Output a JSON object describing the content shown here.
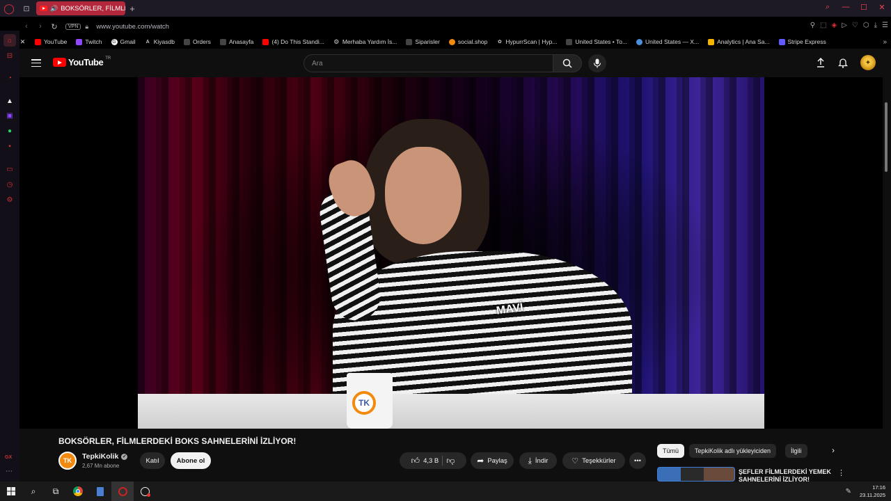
{
  "browser": {
    "tab": {
      "title": "BOKSÖRLER, FİLMLERDEKİ BOKS SAHNELERİNİ İZLİYOR!",
      "audio": "🔊"
    },
    "new_tab": "+",
    "url": "www.youtube.com/watch",
    "vpn": "VPN",
    "bookmarks": [
      {
        "label": "YouTube",
        "icon": "youtube-icon",
        "color": "#ff0000"
      },
      {
        "label": "Twitch",
        "icon": "twitch-icon",
        "color": "#9146ff"
      },
      {
        "label": "Gmail",
        "icon": "google-icon",
        "color": "#ffffff"
      },
      {
        "label": "Kiyasdb",
        "icon": "kiyasdb-icon",
        "color": "#ffffff"
      },
      {
        "label": "Orders",
        "icon": "orders-icon",
        "color": "#555555"
      },
      {
        "label": "Anasayfa",
        "icon": "home-icon",
        "color": "#555555"
      },
      {
        "label": "(4) Do This Standi...",
        "icon": "youtube-icon",
        "color": "#ff0000"
      },
      {
        "label": "Merhaba Yardım İs...",
        "icon": "openai-icon",
        "color": "#cccccc"
      },
      {
        "label": "Siparisler",
        "icon": "orders-icon",
        "color": "#555555"
      },
      {
        "label": "social.shop",
        "icon": "firefox-icon",
        "color": "#f28a10"
      },
      {
        "label": "HypurrScan | Hyp...",
        "icon": "hypurr-icon",
        "color": "#cccccc"
      },
      {
        "label": "United States • To...",
        "icon": "globe-icon",
        "color": "#555555"
      },
      {
        "label": "United States — X...",
        "icon": "globe-icon",
        "color": "#4a90d9"
      },
      {
        "label": "Analytics | Ana Sa...",
        "icon": "analytics-icon",
        "color": "#f4b400"
      },
      {
        "label": "Stripe Express",
        "icon": "stripe-icon",
        "color": "#635bff"
      }
    ]
  },
  "youtube": {
    "logo_text": "YouTube",
    "region": "TR",
    "search_placeholder": "Ara",
    "video": {
      "title": "BOKSÖRLER, FİLMLERDEKİ BOKS SAHNELERİNİ İZLİYOR!",
      "shirt_text": "MAVİ",
      "mug_logo": "TK",
      "channel": "TepkiKolik",
      "channel_initials": "TK",
      "subscribers": "2,67 Mn abone",
      "join": "Katıl",
      "subscribe": "Abone ol",
      "likes": "4,3 B",
      "share": "Paylaş",
      "download": "İndir",
      "thanks": "Teşekkürler"
    },
    "chips": [
      "Tümü",
      "TepkiKolik adlı yükleyiciden",
      "İlgili"
    ],
    "recommendation": {
      "title": "ŞEFLER FİLMLERDEKİ YEMEK SAHNELERİNİ İZLİYOR!"
    }
  },
  "taskbar": {
    "time": "17:16",
    "date": "23.11.2025"
  },
  "colors": {
    "accent": "#e0303c",
    "youtube_red": "#ff0000",
    "tab_active": "#b3273a"
  }
}
